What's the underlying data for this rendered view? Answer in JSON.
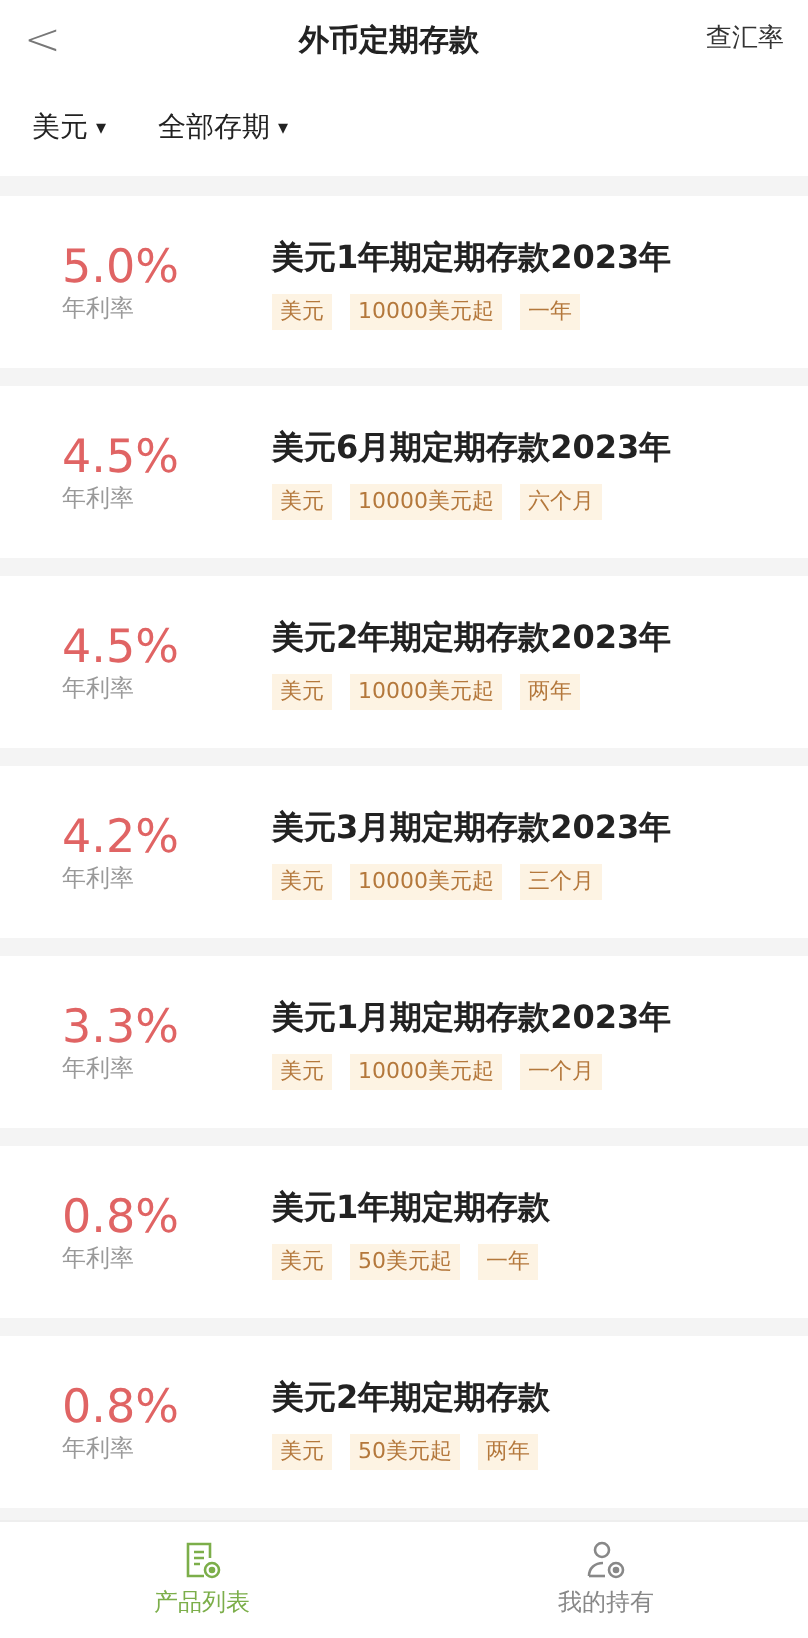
{
  "header": {
    "back": "<",
    "title": "外币定期存款",
    "action": "查汇率"
  },
  "filters": [
    {
      "label": "美元",
      "caret": "▾"
    },
    {
      "label": "全部存期",
      "caret": "▾"
    }
  ],
  "products": [
    {
      "rate": "5.0%",
      "rate_label": "年利率",
      "name": "美元1年期定期存款2023年",
      "tags": [
        "美元",
        "10000美元起",
        "一年"
      ]
    },
    {
      "rate": "4.5%",
      "rate_label": "年利率",
      "name": "美元6月期定期存款2023年",
      "tags": [
        "美元",
        "10000美元起",
        "六个月"
      ]
    },
    {
      "rate": "4.5%",
      "rate_label": "年利率",
      "name": "美元2年期定期存款2023年",
      "tags": [
        "美元",
        "10000美元起",
        "两年"
      ]
    },
    {
      "rate": "4.2%",
      "rate_label": "年利率",
      "name": "美元3月期定期存款2023年",
      "tags": [
        "美元",
        "10000美元起",
        "三个月"
      ]
    },
    {
      "rate": "3.3%",
      "rate_label": "年利率",
      "name": "美元1月期定期存款2023年",
      "tags": [
        "美元",
        "10000美元起",
        "一个月"
      ]
    },
    {
      "rate": "0.8%",
      "rate_label": "年利率",
      "name": "美元1年期定期存款",
      "tags": [
        "美元",
        "50美元起",
        "一年"
      ]
    },
    {
      "rate": "0.8%",
      "rate_label": "年利率",
      "name": "美元2年期定期存款",
      "tags": [
        "美元",
        "50美元起",
        "两年"
      ]
    }
  ],
  "tab_bar": [
    {
      "label": "产品列表",
      "kind": "list",
      "selected": true
    },
    {
      "label": "我的持有",
      "kind": "holdings",
      "selected": false
    }
  ]
}
